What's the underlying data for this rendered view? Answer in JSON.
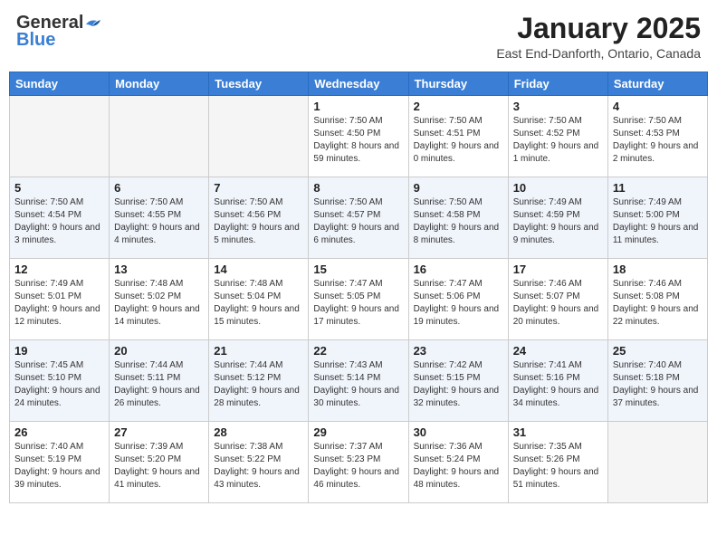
{
  "header": {
    "logo_general": "General",
    "logo_blue": "Blue",
    "month_title": "January 2025",
    "location": "East End-Danforth, Ontario, Canada"
  },
  "weekdays": [
    "Sunday",
    "Monday",
    "Tuesday",
    "Wednesday",
    "Thursday",
    "Friday",
    "Saturday"
  ],
  "weeks": [
    [
      {
        "day": "",
        "sunrise": "",
        "sunset": "",
        "daylight": ""
      },
      {
        "day": "",
        "sunrise": "",
        "sunset": "",
        "daylight": ""
      },
      {
        "day": "",
        "sunrise": "",
        "sunset": "",
        "daylight": ""
      },
      {
        "day": "1",
        "sunrise": "Sunrise: 7:50 AM",
        "sunset": "Sunset: 4:50 PM",
        "daylight": "Daylight: 8 hours and 59 minutes."
      },
      {
        "day": "2",
        "sunrise": "Sunrise: 7:50 AM",
        "sunset": "Sunset: 4:51 PM",
        "daylight": "Daylight: 9 hours and 0 minutes."
      },
      {
        "day": "3",
        "sunrise": "Sunrise: 7:50 AM",
        "sunset": "Sunset: 4:52 PM",
        "daylight": "Daylight: 9 hours and 1 minute."
      },
      {
        "day": "4",
        "sunrise": "Sunrise: 7:50 AM",
        "sunset": "Sunset: 4:53 PM",
        "daylight": "Daylight: 9 hours and 2 minutes."
      }
    ],
    [
      {
        "day": "5",
        "sunrise": "Sunrise: 7:50 AM",
        "sunset": "Sunset: 4:54 PM",
        "daylight": "Daylight: 9 hours and 3 minutes."
      },
      {
        "day": "6",
        "sunrise": "Sunrise: 7:50 AM",
        "sunset": "Sunset: 4:55 PM",
        "daylight": "Daylight: 9 hours and 4 minutes."
      },
      {
        "day": "7",
        "sunrise": "Sunrise: 7:50 AM",
        "sunset": "Sunset: 4:56 PM",
        "daylight": "Daylight: 9 hours and 5 minutes."
      },
      {
        "day": "8",
        "sunrise": "Sunrise: 7:50 AM",
        "sunset": "Sunset: 4:57 PM",
        "daylight": "Daylight: 9 hours and 6 minutes."
      },
      {
        "day": "9",
        "sunrise": "Sunrise: 7:50 AM",
        "sunset": "Sunset: 4:58 PM",
        "daylight": "Daylight: 9 hours and 8 minutes."
      },
      {
        "day": "10",
        "sunrise": "Sunrise: 7:49 AM",
        "sunset": "Sunset: 4:59 PM",
        "daylight": "Daylight: 9 hours and 9 minutes."
      },
      {
        "day": "11",
        "sunrise": "Sunrise: 7:49 AM",
        "sunset": "Sunset: 5:00 PM",
        "daylight": "Daylight: 9 hours and 11 minutes."
      }
    ],
    [
      {
        "day": "12",
        "sunrise": "Sunrise: 7:49 AM",
        "sunset": "Sunset: 5:01 PM",
        "daylight": "Daylight: 9 hours and 12 minutes."
      },
      {
        "day": "13",
        "sunrise": "Sunrise: 7:48 AM",
        "sunset": "Sunset: 5:02 PM",
        "daylight": "Daylight: 9 hours and 14 minutes."
      },
      {
        "day": "14",
        "sunrise": "Sunrise: 7:48 AM",
        "sunset": "Sunset: 5:04 PM",
        "daylight": "Daylight: 9 hours and 15 minutes."
      },
      {
        "day": "15",
        "sunrise": "Sunrise: 7:47 AM",
        "sunset": "Sunset: 5:05 PM",
        "daylight": "Daylight: 9 hours and 17 minutes."
      },
      {
        "day": "16",
        "sunrise": "Sunrise: 7:47 AM",
        "sunset": "Sunset: 5:06 PM",
        "daylight": "Daylight: 9 hours and 19 minutes."
      },
      {
        "day": "17",
        "sunrise": "Sunrise: 7:46 AM",
        "sunset": "Sunset: 5:07 PM",
        "daylight": "Daylight: 9 hours and 20 minutes."
      },
      {
        "day": "18",
        "sunrise": "Sunrise: 7:46 AM",
        "sunset": "Sunset: 5:08 PM",
        "daylight": "Daylight: 9 hours and 22 minutes."
      }
    ],
    [
      {
        "day": "19",
        "sunrise": "Sunrise: 7:45 AM",
        "sunset": "Sunset: 5:10 PM",
        "daylight": "Daylight: 9 hours and 24 minutes."
      },
      {
        "day": "20",
        "sunrise": "Sunrise: 7:44 AM",
        "sunset": "Sunset: 5:11 PM",
        "daylight": "Daylight: 9 hours and 26 minutes."
      },
      {
        "day": "21",
        "sunrise": "Sunrise: 7:44 AM",
        "sunset": "Sunset: 5:12 PM",
        "daylight": "Daylight: 9 hours and 28 minutes."
      },
      {
        "day": "22",
        "sunrise": "Sunrise: 7:43 AM",
        "sunset": "Sunset: 5:14 PM",
        "daylight": "Daylight: 9 hours and 30 minutes."
      },
      {
        "day": "23",
        "sunrise": "Sunrise: 7:42 AM",
        "sunset": "Sunset: 5:15 PM",
        "daylight": "Daylight: 9 hours and 32 minutes."
      },
      {
        "day": "24",
        "sunrise": "Sunrise: 7:41 AM",
        "sunset": "Sunset: 5:16 PM",
        "daylight": "Daylight: 9 hours and 34 minutes."
      },
      {
        "day": "25",
        "sunrise": "Sunrise: 7:40 AM",
        "sunset": "Sunset: 5:18 PM",
        "daylight": "Daylight: 9 hours and 37 minutes."
      }
    ],
    [
      {
        "day": "26",
        "sunrise": "Sunrise: 7:40 AM",
        "sunset": "Sunset: 5:19 PM",
        "daylight": "Daylight: 9 hours and 39 minutes."
      },
      {
        "day": "27",
        "sunrise": "Sunrise: 7:39 AM",
        "sunset": "Sunset: 5:20 PM",
        "daylight": "Daylight: 9 hours and 41 minutes."
      },
      {
        "day": "28",
        "sunrise": "Sunrise: 7:38 AM",
        "sunset": "Sunset: 5:22 PM",
        "daylight": "Daylight: 9 hours and 43 minutes."
      },
      {
        "day": "29",
        "sunrise": "Sunrise: 7:37 AM",
        "sunset": "Sunset: 5:23 PM",
        "daylight": "Daylight: 9 hours and 46 minutes."
      },
      {
        "day": "30",
        "sunrise": "Sunrise: 7:36 AM",
        "sunset": "Sunset: 5:24 PM",
        "daylight": "Daylight: 9 hours and 48 minutes."
      },
      {
        "day": "31",
        "sunrise": "Sunrise: 7:35 AM",
        "sunset": "Sunset: 5:26 PM",
        "daylight": "Daylight: 9 hours and 51 minutes."
      },
      {
        "day": "",
        "sunrise": "",
        "sunset": "",
        "daylight": ""
      }
    ]
  ]
}
